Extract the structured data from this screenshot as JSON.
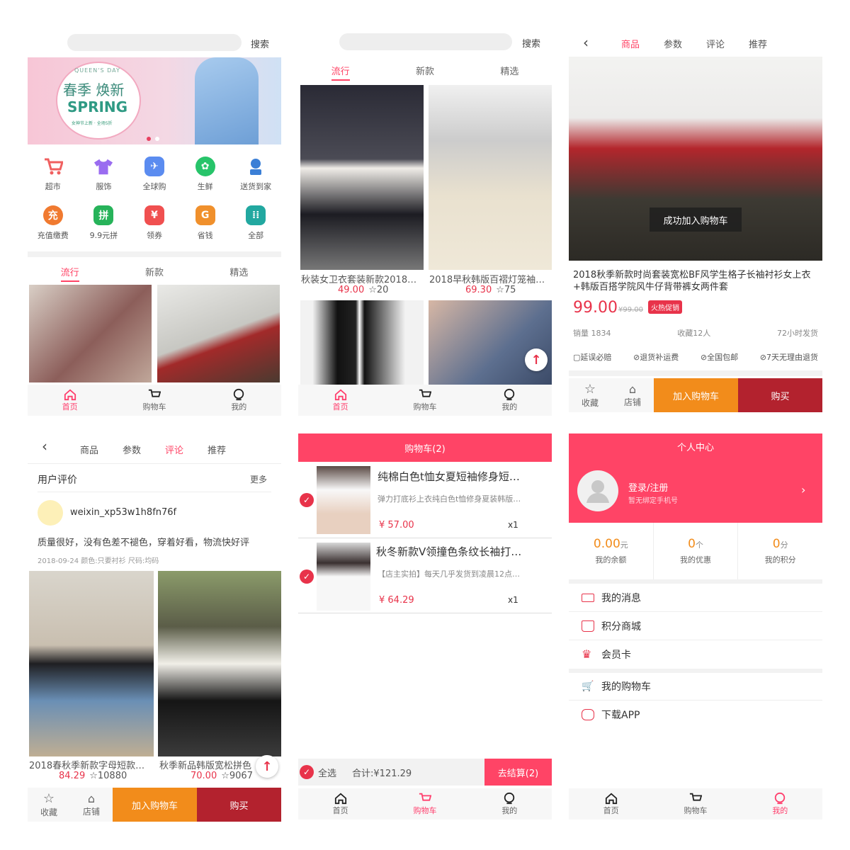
{
  "p1": {
    "search_btn": "搜索",
    "icons": [
      {
        "label": "超市",
        "icon": "cart-icon",
        "color": "#f06060"
      },
      {
        "label": "服饰",
        "icon": "shirt-icon",
        "color": "#9a6cf0"
      },
      {
        "label": "全球购",
        "icon": "plane-icon",
        "color": "#5b8cf0"
      },
      {
        "label": "生鲜",
        "icon": "lime-icon",
        "color": "#27c46a"
      },
      {
        "label": "送货到家",
        "icon": "delivery-icon",
        "color": "#3b7fd6"
      },
      {
        "label": "充值缴费",
        "icon": "recharge-icon",
        "color": "#f07a30",
        "glyph": "充"
      },
      {
        "label": "9.9元拼",
        "icon": "group-buy-icon",
        "color": "#27b35a",
        "glyph": "拼"
      },
      {
        "label": "领券",
        "icon": "coupon-icon",
        "color": "#f05050",
        "glyph": "¥"
      },
      {
        "label": "省钱",
        "icon": "wallet-icon",
        "color": "#f0902c",
        "glyph": "G"
      },
      {
        "label": "全部",
        "icon": "all-icon",
        "color": "#22a8a0",
        "glyph": "⁞⁞"
      }
    ],
    "banner": {
      "en": "QUEEN'S DAY",
      "title": "春季 焕新",
      "spring": "SPRING",
      "sub": "女神节上新 · 全场5折"
    },
    "tabs": [
      "流行",
      "新款",
      "精选"
    ],
    "nav": [
      "首页",
      "购物车",
      "我的"
    ]
  },
  "p2": {
    "search_btn": "搜索",
    "tabs": [
      "流行",
      "新款",
      "精选"
    ],
    "products": [
      {
        "title": "秋装女卫衣套装新款2018…",
        "price": "49.00",
        "likes": "20"
      },
      {
        "title": "2018早秋韩版百褶灯笼袖…",
        "price": "69.30",
        "likes": "75"
      }
    ],
    "nav": [
      "首页",
      "购物车",
      "我的"
    ]
  },
  "p3": {
    "tabs": [
      "商品",
      "参数",
      "评论",
      "推荐"
    ],
    "toast": "成功加入购物车",
    "title": "2018秋季新款时尚套装宽松BF风学生格子长袖衬衫女上衣+韩版百搭学院风牛仔背带裤女两件套",
    "price": "99.00",
    "old_price": "¥99.00",
    "badge": "火热促销",
    "sales": "销量 1834",
    "fav": "收藏12人",
    "ship": "72小时发货",
    "guarantees": [
      "延误必赔",
      "退货补运费",
      "全国包邮",
      "7天无理由退货"
    ],
    "bar": {
      "fav": "收藏",
      "shop": "店铺",
      "cart": "加入购物车",
      "buy": "购买"
    }
  },
  "p4": {
    "tabs": [
      "商品",
      "参数",
      "评论",
      "推荐"
    ],
    "section": "用户评价",
    "more": "更多",
    "user": "weixin_xp53w1h8fn76f",
    "comment": "质量很好，没有色差不褪色，穿着好看，物流快好评",
    "meta": "2018-09-24  颜色:只要衬衫 尺码:均码",
    "products": [
      {
        "title": "2018春秋季新款字母短款…",
        "price": "84.29",
        "likes": "10880"
      },
      {
        "title": "秋季新品韩版宽松拼色",
        "price": "70.00",
        "likes": "9067"
      }
    ],
    "bar": {
      "fav": "收藏",
      "shop": "店铺",
      "cart": "加入购物车",
      "buy": "购买"
    }
  },
  "p5": {
    "header": "购物车(2)",
    "items": [
      {
        "title": "纯棉白色t恤女夏短袖修身短…",
        "desc": "弹力打底衫上衣纯白色t恤修身夏装韩版…",
        "price": "¥ 57.00",
        "qty": "x1"
      },
      {
        "title": "秋冬新款V领撞色条纹长袖打…",
        "desc": "【店主实拍】每天几乎发货到凌晨12点…",
        "price": "¥ 64.29",
        "qty": "x1"
      }
    ],
    "select_all": "全选",
    "total": "合计:¥121.29",
    "checkout": "去结算(2)",
    "nav": [
      "首页",
      "购物车",
      "我的"
    ]
  },
  "p6": {
    "header": "个人中心",
    "login": "登录/注册",
    "login_sub": "暂无绑定手机号",
    "stats": [
      {
        "num": "0.00",
        "unit": "元",
        "label": "我的余额"
      },
      {
        "num": "0",
        "unit": "个",
        "label": "我的优惠"
      },
      {
        "num": "0",
        "unit": "分",
        "label": "我的积分"
      }
    ],
    "menu": [
      "我的消息",
      "积分商城",
      "会员卡",
      "我的购物车",
      "下载APP"
    ],
    "nav": [
      "首页",
      "购物车",
      "我的"
    ]
  }
}
